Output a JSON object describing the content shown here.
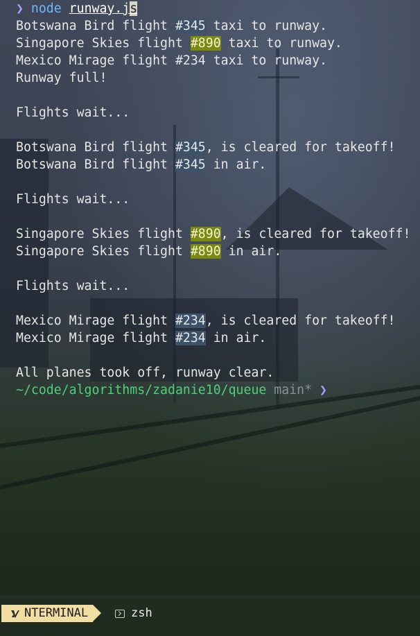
{
  "terminal": {
    "prompt_symbol": "❯",
    "command": "node",
    "file_pre_cursor": "runway.j",
    "file_cursor_char": "s",
    "output": [
      {
        "a": "Botswana Bird flight ",
        "hl": "#345",
        "b": " taxi to runway.",
        "kind": "blue"
      },
      {
        "a": "Singapore Skies flight ",
        "hl": "#890",
        "b": " taxi to runway.",
        "kind": "olive"
      },
      {
        "a": "Mexico Mirage flight ",
        "hl": "#234",
        "b": " taxi to runway.",
        "kind": "none"
      },
      {
        "a": "Runway full!",
        "hl": "",
        "b": "",
        "kind": "none"
      },
      {
        "a": "",
        "hl": "",
        "b": "",
        "kind": "none"
      },
      {
        "a": "Flights wait...",
        "hl": "",
        "b": "",
        "kind": "none"
      },
      {
        "a": "",
        "hl": "",
        "b": "",
        "kind": "none"
      },
      {
        "a": "Botswana Bird flight ",
        "hl": "#345",
        "b": ", is cleared for takeoff!",
        "kind": "blue"
      },
      {
        "a": "Botswana Bird flight ",
        "hl": "#345",
        "b": " in air.",
        "kind": "blue"
      },
      {
        "a": "",
        "hl": "",
        "b": "",
        "kind": "none"
      },
      {
        "a": "Flights wait...",
        "hl": "",
        "b": "",
        "kind": "none"
      },
      {
        "a": "",
        "hl": "",
        "b": "",
        "kind": "none"
      },
      {
        "a": "Singapore Skies flight ",
        "hl": "#890",
        "b": ", is cleared for takeoff!",
        "kind": "olive"
      },
      {
        "a": "Singapore Skies flight ",
        "hl": "#890",
        "b": " in air.",
        "kind": "olive"
      },
      {
        "a": "",
        "hl": "",
        "b": "",
        "kind": "none"
      },
      {
        "a": "Flights wait...",
        "hl": "",
        "b": "",
        "kind": "none"
      },
      {
        "a": "",
        "hl": "",
        "b": "",
        "kind": "none"
      },
      {
        "a": "Mexico Mirage flight ",
        "hl": "#234",
        "b": ", is cleared for takeoff!",
        "kind": "blue"
      },
      {
        "a": "Mexico Mirage flight ",
        "hl": "#234",
        "b": " in air.",
        "kind": "blue"
      },
      {
        "a": "",
        "hl": "",
        "b": "",
        "kind": "none"
      },
      {
        "a": "All planes took off, runway clear.",
        "hl": "",
        "b": "",
        "kind": "none"
      }
    ],
    "cwd": "~/code/algorithms/zadanie10/queue",
    "git_branch": "main*",
    "prompt_end_symbol": "❯"
  },
  "statusbar": {
    "mode_label": "NTERMINAL",
    "mode_icon": "vim-icon",
    "tab_icon": "terminal-icon",
    "tab_label": "zsh"
  },
  "colors": {
    "prompt_symbol": "#a6a0ff",
    "command": "#6fb8ff",
    "path": "#4fd07a",
    "branch": "#8a8f99",
    "highlight_blue": "#3c5268",
    "highlight_olive": "#7a8a10",
    "mode_bg": "#f3dea2"
  }
}
